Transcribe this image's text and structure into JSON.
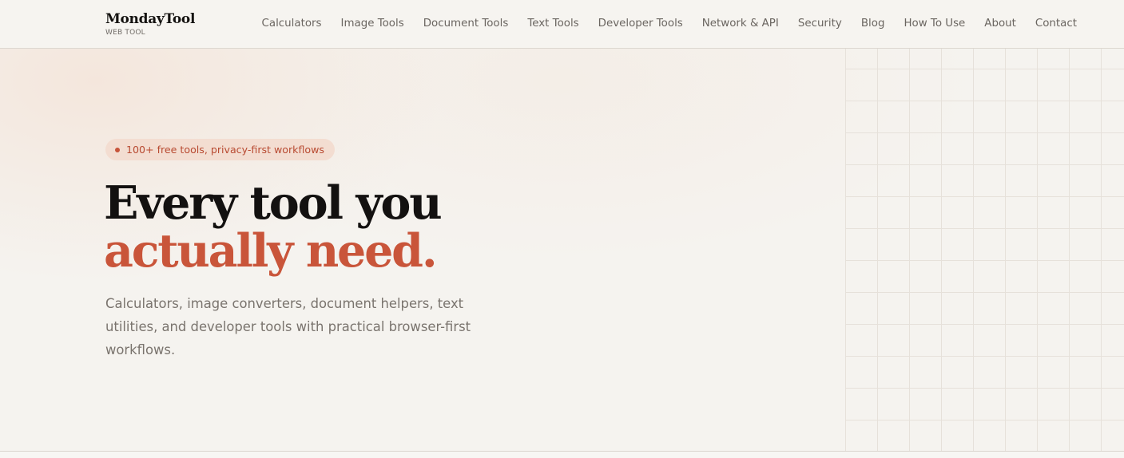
{
  "brand": {
    "name": "MondayTool",
    "subtitle": "WEB TOOL"
  },
  "nav": {
    "items": [
      {
        "label": "Calculators"
      },
      {
        "label": "Image Tools"
      },
      {
        "label": "Document Tools"
      },
      {
        "label": "Text Tools"
      },
      {
        "label": "Developer Tools"
      },
      {
        "label": "Network & API"
      },
      {
        "label": "Security"
      },
      {
        "label": "Blog"
      },
      {
        "label": "How To Use"
      },
      {
        "label": "About"
      },
      {
        "label": "Contact"
      }
    ]
  },
  "hero": {
    "badge": "100+ free tools, privacy-first workflows",
    "headline_line1": "Every tool you",
    "headline_line2": "actually need.",
    "subtext": "Calculators, image converters, document helpers, text utilities, and developer tools with practical browser-first workflows."
  },
  "colors": {
    "accent": "#c9553a",
    "badge_bg": "#f3ddd1",
    "page_bg": "#f5f3ef",
    "heading": "#131110",
    "muted_text": "#7a746e"
  }
}
